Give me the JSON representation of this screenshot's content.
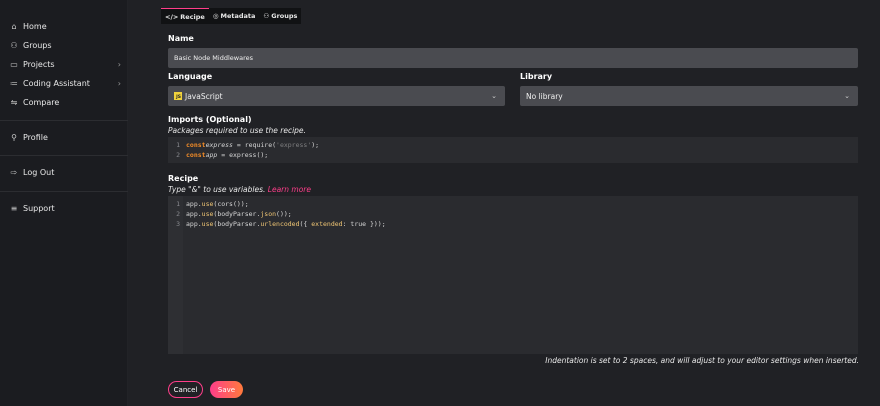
{
  "sidebar": {
    "items": [
      {
        "label": "Home",
        "icon": "home-icon",
        "glyph": "⌂"
      },
      {
        "label": "Groups",
        "icon": "groups-icon",
        "glyph": "⚇"
      },
      {
        "label": "Projects",
        "icon": "projects-icon",
        "glyph": "▭"
      },
      {
        "label": "Coding Assistant",
        "icon": "list-icon",
        "glyph": "≔"
      },
      {
        "label": "Compare",
        "icon": "compare-icon",
        "glyph": "⇋"
      },
      {
        "label": "Profile",
        "icon": "profile-icon",
        "glyph": "⚲"
      },
      {
        "label": "Log Out",
        "icon": "logout-icon",
        "glyph": "⇨"
      },
      {
        "label": "Support",
        "icon": "support-icon",
        "glyph": "≡"
      }
    ],
    "chevron": "›"
  },
  "tabs": [
    {
      "label": "Recipe",
      "glyph": "</>"
    },
    {
      "label": "Metadata",
      "glyph": "◎"
    },
    {
      "label": "Groups",
      "glyph": "⚇"
    }
  ],
  "form": {
    "name_label": "Name",
    "name_value": "Basic Node Middlewares",
    "language_label": "Language",
    "language_value": "JavaScript",
    "js_badge": "JS",
    "library_label": "Library",
    "library_value": "No library",
    "caret": "⌄",
    "imports_label": "Imports (Optional)",
    "imports_help": "Packages required to use the recipe.",
    "recipe_label": "Recipe",
    "recipe_help": "Type \"&\" to use variables.",
    "recipe_link": "Learn more",
    "indent_note": "Indentation is set to 2 spaces, and will adjust to your editor settings when inserted.",
    "cancel_label": "Cancel",
    "save_label": "Save"
  },
  "imports_code": {
    "line_numbers": [
      "1",
      "2"
    ]
  },
  "recipe_code": {
    "line_numbers": [
      "1",
      "2",
      "3"
    ]
  },
  "colors": {
    "accent": "#ff3e8a",
    "accent_2": "#ff7a3c",
    "keyword": "#f28c28",
    "function": "#f0c674"
  }
}
